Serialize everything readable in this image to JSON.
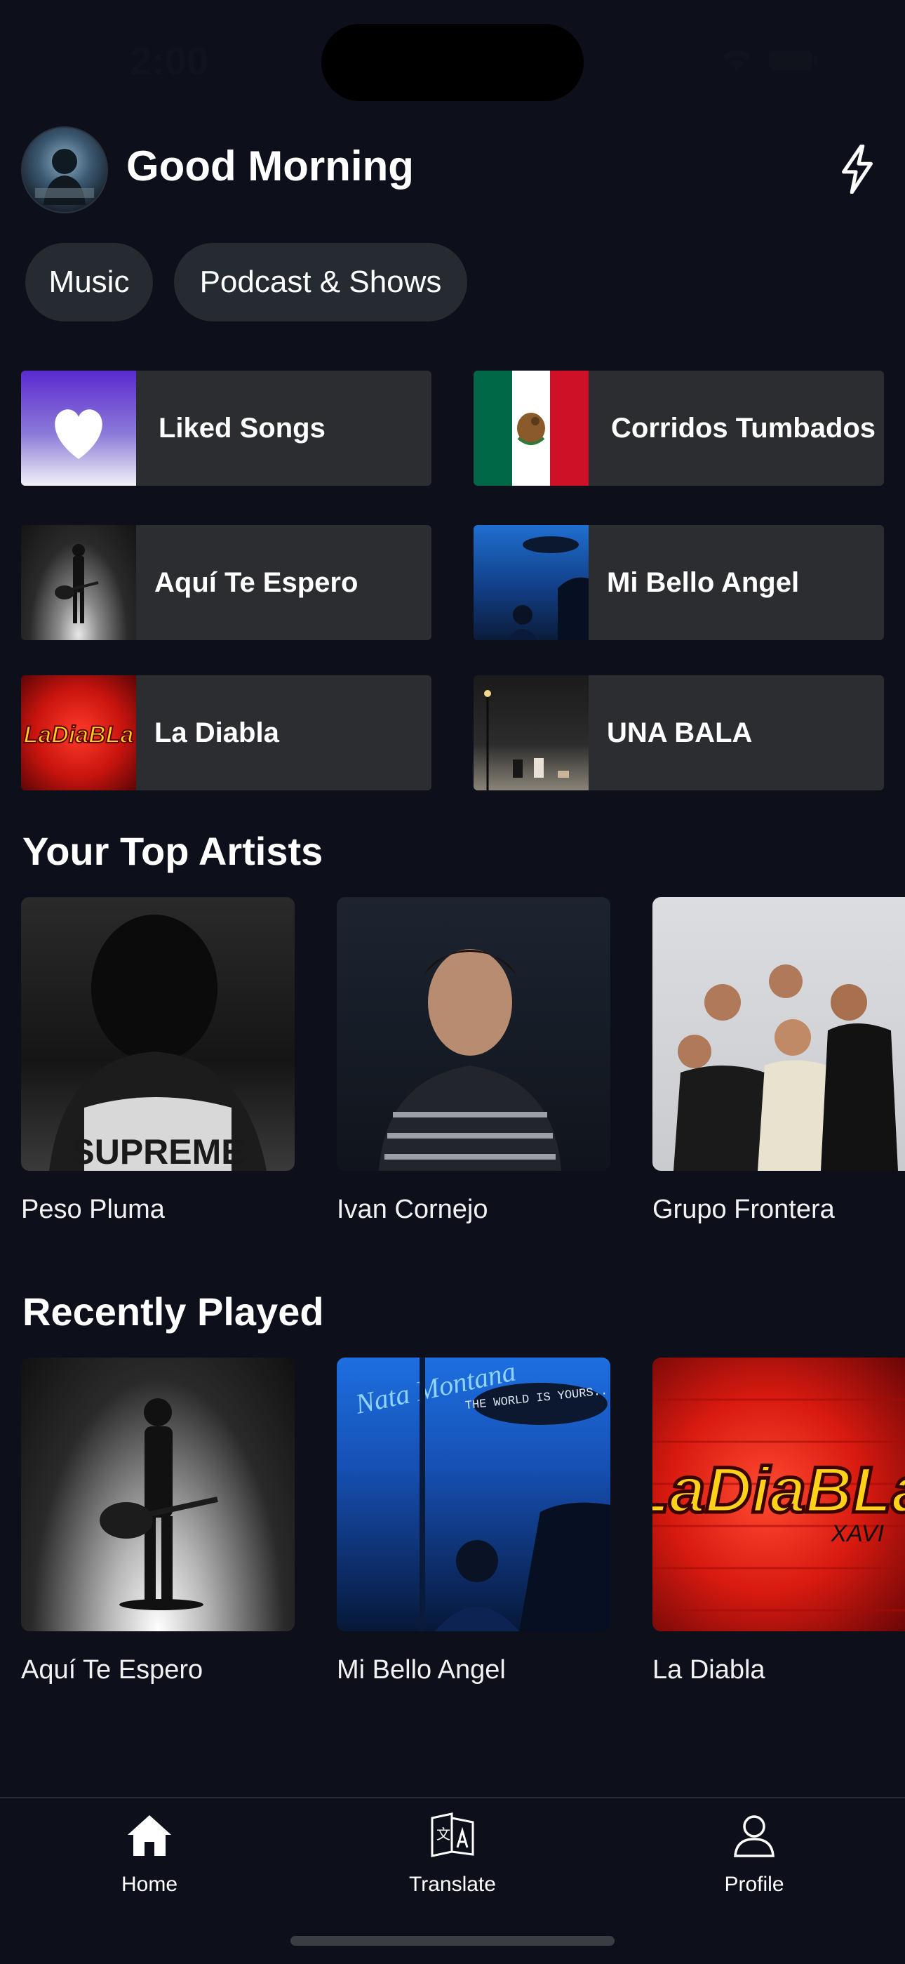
{
  "status_bar": {
    "time": "2:00"
  },
  "header": {
    "greeting": "Good Morning"
  },
  "chips": [
    "Music",
    "Podcast & Shows"
  ],
  "shortcuts": [
    {
      "label": "Liked Songs"
    },
    {
      "label": "Corridos Tumbados"
    },
    {
      "label": "Aquí Te Espero"
    },
    {
      "label": "Mi Bello Angel"
    },
    {
      "label": "La Diabla"
    },
    {
      "label": "UNA BALA"
    }
  ],
  "top_artists": {
    "title": "Your Top Artists",
    "items": [
      {
        "name": "Peso Pluma"
      },
      {
        "name": "Ivan Cornejo"
      },
      {
        "name": "Grupo Frontera"
      }
    ]
  },
  "recently_played": {
    "title": "Recently Played",
    "items": [
      {
        "name": "Aquí Te Espero"
      },
      {
        "name": "Mi Bello Angel"
      },
      {
        "name": "La Diabla"
      }
    ]
  },
  "art_text": {
    "la_diabla": "LaDiaBLa",
    "xavi": "XAVI",
    "nata_montana": "Nata Montana",
    "blimp": "THE WORLD IS YOURS...",
    "supreme": "SUPREME"
  },
  "nav": [
    {
      "label": "Home",
      "icon": "home-icon"
    },
    {
      "label": "Translate",
      "icon": "translate-icon"
    },
    {
      "label": "Profile",
      "icon": "profile-icon"
    }
  ],
  "colors": {
    "background": "#0d0f1a",
    "tile": "#2b2d31",
    "chip": "#262a31",
    "liked_gradient_top": "#5a2ad0"
  }
}
